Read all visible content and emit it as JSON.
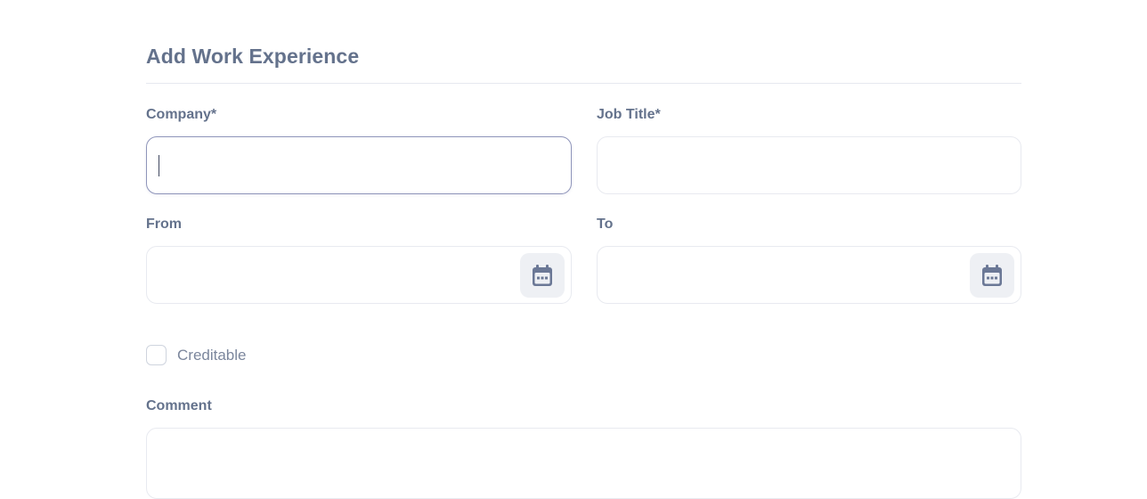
{
  "form": {
    "title": "Add Work Experience",
    "company": {
      "label": "Company*",
      "value": ""
    },
    "job_title": {
      "label": "Job Title*",
      "value": ""
    },
    "from": {
      "label": "From",
      "value": "",
      "icon": "calendar-icon"
    },
    "to": {
      "label": "To",
      "value": "",
      "icon": "calendar-icon"
    },
    "creditable": {
      "label": "Creditable",
      "checked": false
    },
    "comment": {
      "label": "Comment",
      "value": ""
    }
  },
  "colors": {
    "text": "#64728c",
    "border": "#e8eaf0",
    "focus_border": "#8f95ba",
    "icon_bg": "#eef0f4"
  }
}
